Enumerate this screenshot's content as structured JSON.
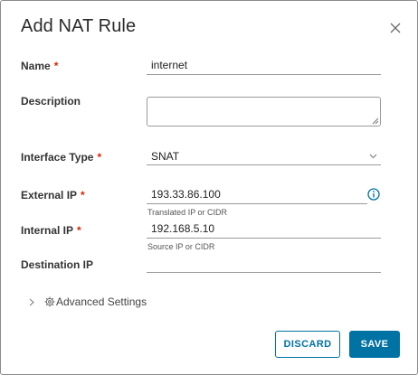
{
  "dialog": {
    "title": "Add NAT Rule",
    "close_icon": "close-icon"
  },
  "form": {
    "name": {
      "label": "Name",
      "required_mark": "*",
      "value": "internet"
    },
    "description": {
      "label": "Description",
      "value": ""
    },
    "interface_type": {
      "label": "Interface Type",
      "required_mark": "*",
      "selected": "SNAT"
    },
    "external_ip": {
      "label": "External IP",
      "required_mark": "*",
      "value": "193.33.86.100",
      "helper": "Translated IP or CIDR",
      "info_icon": "info-icon"
    },
    "internal_ip": {
      "label": "Internal IP",
      "required_mark": "*",
      "value": "192.168.5.10",
      "helper": "Source IP or CIDR"
    },
    "destination_ip": {
      "label": "Destination IP",
      "value": ""
    }
  },
  "advanced": {
    "label": "Advanced Settings",
    "icons": [
      "chevron-right-icon",
      "gear-icon"
    ]
  },
  "buttons": {
    "discard": "DISCARD",
    "save": "SAVE"
  },
  "colors": {
    "primary": "#0072a3",
    "required": "#e12200",
    "text": "#333333"
  }
}
